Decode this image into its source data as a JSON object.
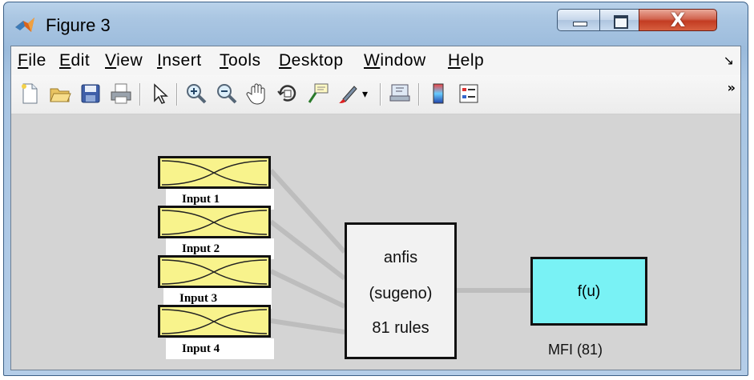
{
  "window": {
    "title": "Figure 3",
    "controls": {
      "minimize": "—",
      "maximize": "□",
      "close": "X"
    }
  },
  "menubar": {
    "items": [
      {
        "accel": "F",
        "rest": "ile"
      },
      {
        "accel": "E",
        "rest": "dit"
      },
      {
        "accel": "V",
        "rest": "iew"
      },
      {
        "accel": "I",
        "rest": "nsert"
      },
      {
        "accel": "T",
        "rest": "ools"
      },
      {
        "accel": "D",
        "rest": "esktop"
      },
      {
        "accel": "W",
        "rest": "indow"
      },
      {
        "accel": "H",
        "rest": "elp"
      }
    ],
    "corner_glyph": "↘"
  },
  "toolbar": {
    "buttons": [
      "new-figure",
      "open-file",
      "save",
      "print",
      "edit-plot-arrow",
      "zoom-in",
      "zoom-out",
      "pan-hand",
      "rotate-3d",
      "data-cursor",
      "brush",
      "brush-dropdown",
      "link-plot",
      "colorbar",
      "legend"
    ],
    "overflow": "»"
  },
  "diagram": {
    "inputs": [
      {
        "label": "Input 1"
      },
      {
        "label": "Input 2"
      },
      {
        "label": "Input 3"
      },
      {
        "label": "Input 4"
      }
    ],
    "system": {
      "line1": "anfis",
      "line2": "(sugeno)",
      "line3": "81 rules"
    },
    "output": {
      "func": "f(u)",
      "label": "MFI (81)"
    },
    "colors": {
      "input_fill": "#f8f38c",
      "output_fill": "#79f2f5",
      "system_fill": "#f2f2f2",
      "connector": "#bdbdbd",
      "canvas": "#d4d4d4"
    }
  }
}
